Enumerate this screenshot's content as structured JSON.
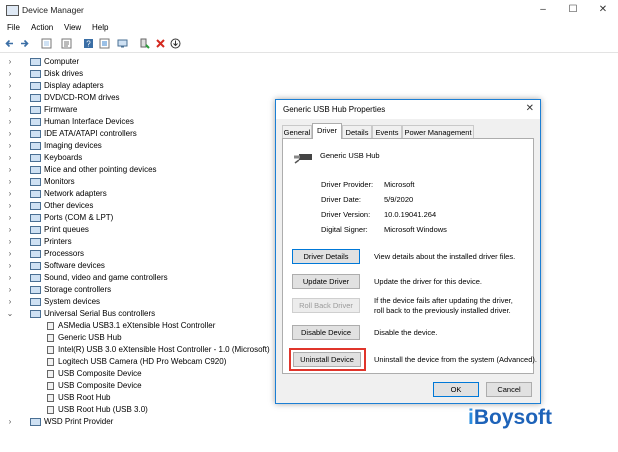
{
  "window": {
    "title": "Device Manager",
    "controls": [
      "–",
      "☐",
      "✕"
    ]
  },
  "menu": [
    "File",
    "Action",
    "View",
    "Help"
  ],
  "toolbar_icons": [
    "back-icon",
    "forward-icon",
    "show-hide-icon",
    "properties-icon",
    "help-icon",
    "update-driver-icon",
    "scan-icon",
    "enable-icon",
    "uninstall-icon",
    "download-icon"
  ],
  "tree": {
    "categories": [
      "Computer",
      "Disk drives",
      "Display adapters",
      "DVD/CD-ROM drives",
      "Firmware",
      "Human Interface Devices",
      "IDE ATA/ATAPI controllers",
      "Imaging devices",
      "Keyboards",
      "Mice and other pointing devices",
      "Monitors",
      "Network adapters",
      "Other devices",
      "Ports (COM & LPT)",
      "Print queues",
      "Printers",
      "Processors",
      "Software devices",
      "Sound, video and game controllers",
      "Storage controllers",
      "System devices"
    ],
    "usb": {
      "label": "Universal Serial Bus controllers",
      "children": [
        "ASMedia USB3.1 eXtensible Host Controller",
        "Generic USB Hub",
        "Intel(R) USB 3.0 eXtensible Host Controller - 1.0 (Microsoft)",
        "Logitech USB Camera (HD Pro Webcam C920)",
        "USB Composite Device",
        "USB Composite Device",
        "USB Root Hub",
        "USB Root Hub (USB 3.0)"
      ]
    },
    "last": "WSD Print Provider"
  },
  "dialog": {
    "title": "Generic USB Hub Properties",
    "close": "✕",
    "tabs": [
      "General",
      "Driver",
      "Details",
      "Events",
      "Power Management"
    ],
    "active_tab": "Driver",
    "device_name": "Generic USB Hub",
    "info": [
      {
        "label": "Driver Provider:",
        "value": "Microsoft"
      },
      {
        "label": "Driver Date:",
        "value": "5/9/2020"
      },
      {
        "label": "Driver Version:",
        "value": "10.0.19041.264"
      },
      {
        "label": "Digital Signer:",
        "value": "Microsoft Windows"
      }
    ],
    "actions": [
      {
        "button": "Driver Details",
        "desc": "View details about the installed driver files."
      },
      {
        "button": "Update Driver",
        "desc": "Update the driver for this device."
      },
      {
        "button": "Roll Back Driver",
        "desc": "If the device fails after updating the driver, roll back to the previously installed driver."
      },
      {
        "button": "Disable Device",
        "desc": "Disable the device."
      },
      {
        "button": "Uninstall Device",
        "desc": "Uninstall the device from the system (Advanced)."
      }
    ],
    "ok": "OK",
    "cancel": "Cancel"
  },
  "watermark": {
    "prefix": "i",
    "text": "Boysoft"
  },
  "colors": {
    "accent": "#0078d7",
    "highlight": "#e0352b",
    "brand": "#1e63b9"
  }
}
